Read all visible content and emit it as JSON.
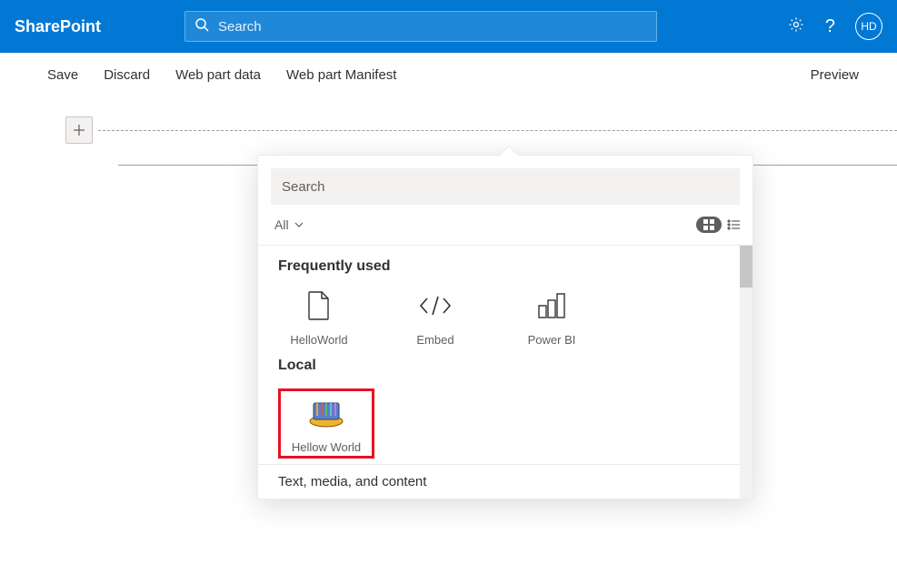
{
  "header": {
    "brand": "SharePoint",
    "search_placeholder": "Search",
    "avatar_initials": "HD"
  },
  "cmdbar": {
    "save": "Save",
    "discard": "Discard",
    "webpart_data": "Web part data",
    "webpart_manifest": "Web part Manifest",
    "preview": "Preview"
  },
  "popup": {
    "search_placeholder": "Search",
    "filter_label": "All",
    "sections": {
      "frequently_used": {
        "title": "Frequently used",
        "items": [
          {
            "label": "HelloWorld",
            "icon": "file"
          },
          {
            "label": "Embed",
            "icon": "code"
          },
          {
            "label": "Power BI",
            "icon": "chart"
          }
        ]
      },
      "local": {
        "title": "Local",
        "items": [
          {
            "label": "Hellow World",
            "icon": "custom"
          }
        ]
      },
      "text_media": {
        "title": "Text, media, and content"
      }
    }
  }
}
